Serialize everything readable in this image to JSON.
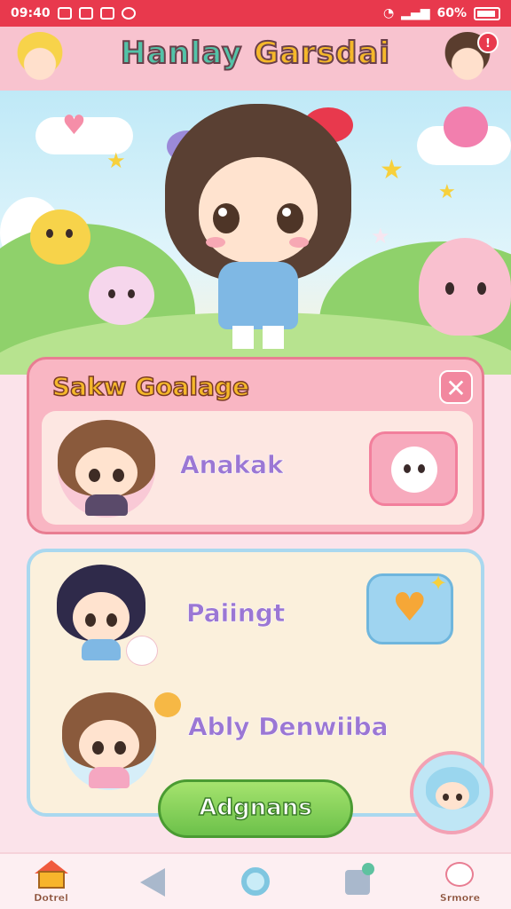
{
  "status_bar": {
    "time": "09:40",
    "battery": "60%"
  },
  "header": {
    "title_part1": "Hanlay",
    "title_part2": "Garsdai",
    "badge_count": "!"
  },
  "panel_top": {
    "title": "Sakw Goalage",
    "close_symbol": "✕",
    "friend_name": "Anakak"
  },
  "panel_bottom": {
    "friends": [
      {
        "name": "Paiingt"
      },
      {
        "name": "Ably Denwiiba"
      }
    ],
    "primary_button": "Adgnans"
  },
  "nav": {
    "items": [
      {
        "label": "Dotrel",
        "icon": "home-icon"
      },
      {
        "label": "",
        "icon": "back-triangle-icon"
      },
      {
        "label": "",
        "icon": "circle-icon"
      },
      {
        "label": "",
        "icon": "message-icon"
      },
      {
        "label": "Srmore",
        "icon": "cat-icon"
      }
    ]
  },
  "colors": {
    "status_bar": "#e8394d",
    "header_bg": "#f8c3cf",
    "title_mint": "#53c3a8",
    "title_yellow": "#f5b82a",
    "name_purple": "#9b77d4",
    "primary_green": "#6cc14a"
  },
  "icons": [
    "heart-icon",
    "star-icon",
    "close-icon",
    "cat-face-icon",
    "heart-button-icon",
    "sparkle-icon"
  ]
}
